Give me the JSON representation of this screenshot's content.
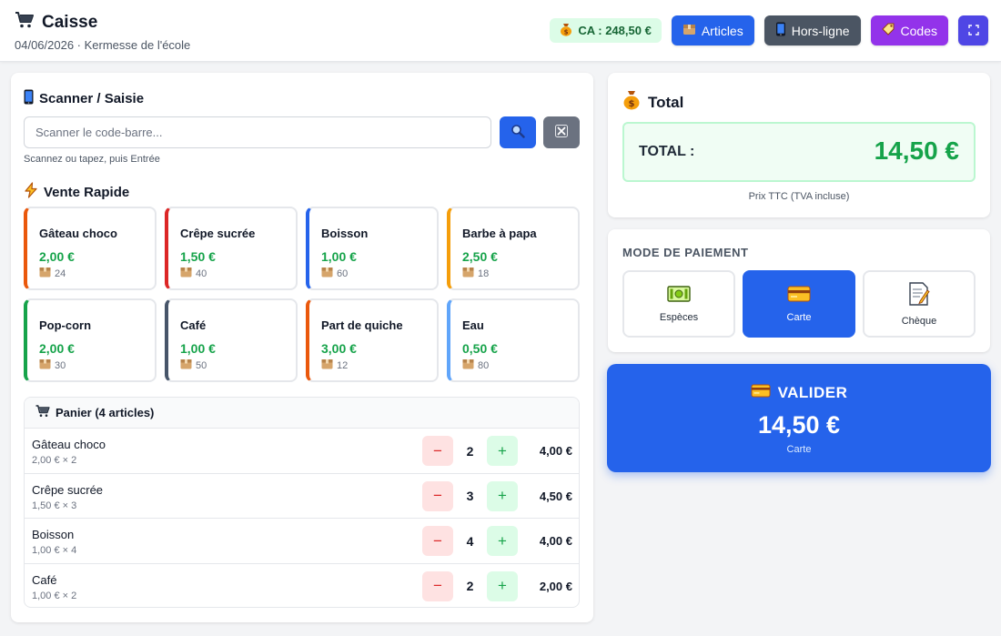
{
  "header": {
    "title": "Caisse",
    "subtitle": "04/06/2026 · Kermesse de l'école",
    "ca_badge": "CA : 248,50 €",
    "buttons": {
      "articles": "Articles",
      "offline": "Hors-ligne",
      "codes": "Codes"
    }
  },
  "scanner": {
    "title": "Scanner / Saisie",
    "placeholder": "Scanner le code-barre...",
    "hint": "Scannez ou tapez, puis Entrée"
  },
  "quick_sale": {
    "title": "Vente Rapide",
    "items": [
      {
        "name": "Gâteau choco",
        "price": "2,00 €",
        "stock": "24",
        "color": "#ea580c"
      },
      {
        "name": "Crêpe sucrée",
        "price": "1,50 €",
        "stock": "40",
        "color": "#dc2626"
      },
      {
        "name": "Boisson",
        "price": "1,00 €",
        "stock": "60",
        "color": "#2563eb"
      },
      {
        "name": "Barbe à papa",
        "price": "2,50 €",
        "stock": "18",
        "color": "#f59e0b"
      },
      {
        "name": "Pop-corn",
        "price": "2,00 €",
        "stock": "30",
        "color": "#16a34a"
      },
      {
        "name": "Café",
        "price": "1,00 €",
        "stock": "50",
        "color": "#475569"
      },
      {
        "name": "Part de quiche",
        "price": "3,00 €",
        "stock": "12",
        "color": "#ea580c"
      },
      {
        "name": "Eau",
        "price": "0,50 €",
        "stock": "80",
        "color": "#60a5fa"
      }
    ]
  },
  "cart": {
    "title": "Panier (4 articles)",
    "items": [
      {
        "name": "Gâteau choco",
        "unit": "2,00 € × 2",
        "qty": "2",
        "total": "4,00 €"
      },
      {
        "name": "Crêpe sucrée",
        "unit": "1,50 € × 3",
        "qty": "3",
        "total": "4,50 €"
      },
      {
        "name": "Boisson",
        "unit": "1,00 € × 4",
        "qty": "4",
        "total": "4,00 €"
      },
      {
        "name": "Café",
        "unit": "1,00 € × 2",
        "qty": "2",
        "total": "2,00 €"
      }
    ],
    "minus": "−",
    "plus": "+"
  },
  "total": {
    "title": "Total",
    "label": "TOTAL :",
    "value": "14,50 €",
    "note": "Prix TTC (TVA incluse)"
  },
  "payment": {
    "title": "MODE DE PAIEMENT",
    "methods": [
      {
        "label": "Espèces",
        "icon": "cash-icon",
        "active": false
      },
      {
        "label": "Carte",
        "icon": "credit-card-icon",
        "active": true
      },
      {
        "label": "Chèque",
        "icon": "cheque-icon",
        "active": false
      }
    ]
  },
  "validate": {
    "label": "VALIDER",
    "amount": "14,50 €",
    "method": "Carte"
  }
}
